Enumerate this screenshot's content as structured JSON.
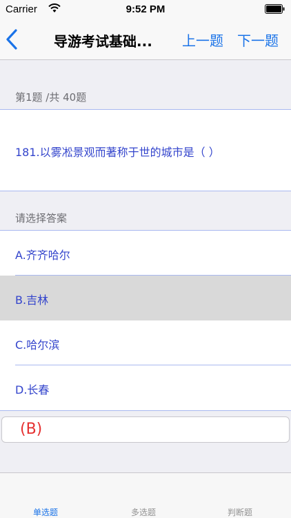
{
  "status_bar": {
    "carrier": "Carrier",
    "time": "9:52 PM",
    "wifi_icon": "wifi-icon",
    "battery_icon": "battery-icon"
  },
  "nav": {
    "back_icon": "chevron-left-icon",
    "title": "导游考试基础...",
    "prev_label": "上一题",
    "next_label": "下一题",
    "accent_color": "#1a73e8"
  },
  "quiz": {
    "progress": "第1题 /共 40题",
    "question": "181.以雾凇景观而著称于世的城市是（    ）",
    "answer_prompt": "请选择答案",
    "options": [
      {
        "label": "A.齐齐哈尔",
        "selected": false
      },
      {
        "label": "B.吉林",
        "selected": true
      },
      {
        "label": "C.哈尔滨",
        "selected": false
      },
      {
        "label": "D.长春",
        "selected": false
      }
    ],
    "answer_result": "(B)",
    "text_color": "#3344cc",
    "result_color": "#e53030"
  },
  "tabs": [
    {
      "label": "单选题",
      "active": true
    },
    {
      "label": "多选题",
      "active": false
    },
    {
      "label": "判断题",
      "active": false
    }
  ]
}
